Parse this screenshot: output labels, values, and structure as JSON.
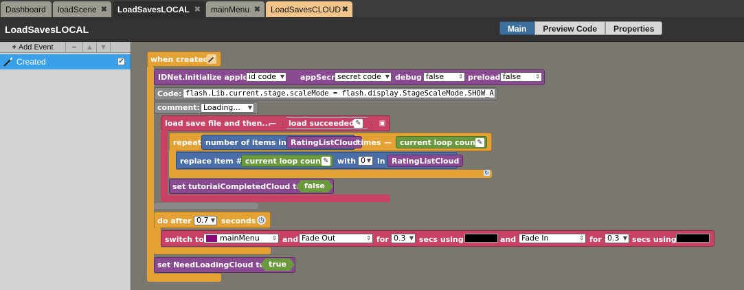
{
  "tabs": [
    {
      "label": "Dashboard",
      "closable": false
    },
    {
      "label": "loadScene",
      "closable": true
    },
    {
      "label": "LoadSavesLOCAL",
      "closable": true,
      "active": true
    },
    {
      "label": "mainMenu",
      "closable": true
    },
    {
      "label": "LoadSavesCLOUD",
      "closable": true,
      "highlight": true
    }
  ],
  "close_glyph": "✖",
  "scene_title": "LoadSavesLOCAL",
  "view_buttons": {
    "main": "Main",
    "preview": "Preview Code",
    "properties": "Properties"
  },
  "events_toolbar": {
    "add_event": "Add Event",
    "plus": "+",
    "minus": "−",
    "up": "▲",
    "down": "▼"
  },
  "events": [
    {
      "label": "Created",
      "checked": true
    }
  ],
  "blocks": {
    "when_created": "when created",
    "idnet": {
      "label": "IDNet.initialize appId",
      "appid": "id code",
      "appsecret_lbl": "appSecret",
      "appsecret": "secret code",
      "debug_lbl": "debug",
      "debug": "false",
      "preload_lbl": "preload",
      "preload": "false"
    },
    "code": {
      "label": "Code:",
      "value": "flash.Lib.current.stage.scaleMode = flash.display.StageScaleMode.SHOW_ALL;"
    },
    "comment": {
      "label": "comment:",
      "value": "Loading..."
    },
    "load_save": {
      "label": "load save file and then...",
      "dash": "—",
      "callback": "load succeeded"
    },
    "repeat": {
      "label": "repeat",
      "count_lbl": "number of items in",
      "list": "RatingListCloud",
      "times": "times",
      "dash": "—",
      "var": "current loop count"
    },
    "replace": {
      "label": "replace item #",
      "var": "current loop count",
      "with": "with",
      "val": "0",
      "in": "in",
      "list": "RatingListCloud"
    },
    "set_tutorial": {
      "label": "set tutorialCompletedCloud to",
      "val": "false"
    },
    "do_after": {
      "label": "do after",
      "val": "0.7",
      "unit": "seconds"
    },
    "switch": {
      "label": "switch to",
      "scene": "mainMenu",
      "and1": "and",
      "trans_out": "Fade Out",
      "for1": "for",
      "secs1": "0.3",
      "using1": "secs using",
      "and2": "and",
      "trans_in": "Fade In",
      "for2": "for",
      "secs2": "0.3",
      "using2": "secs using"
    },
    "set_loading": {
      "label": "set NeedLoadingCloud to",
      "val": "true"
    }
  },
  "colors": {
    "orange": "#e4a134",
    "purple": "#8a4a91",
    "gray": "#8a8a8a",
    "crimson": "#c84266",
    "blue": "#4a6fa8",
    "green": "#6b9a3e",
    "scene_swatch": "#8a0a7a"
  }
}
